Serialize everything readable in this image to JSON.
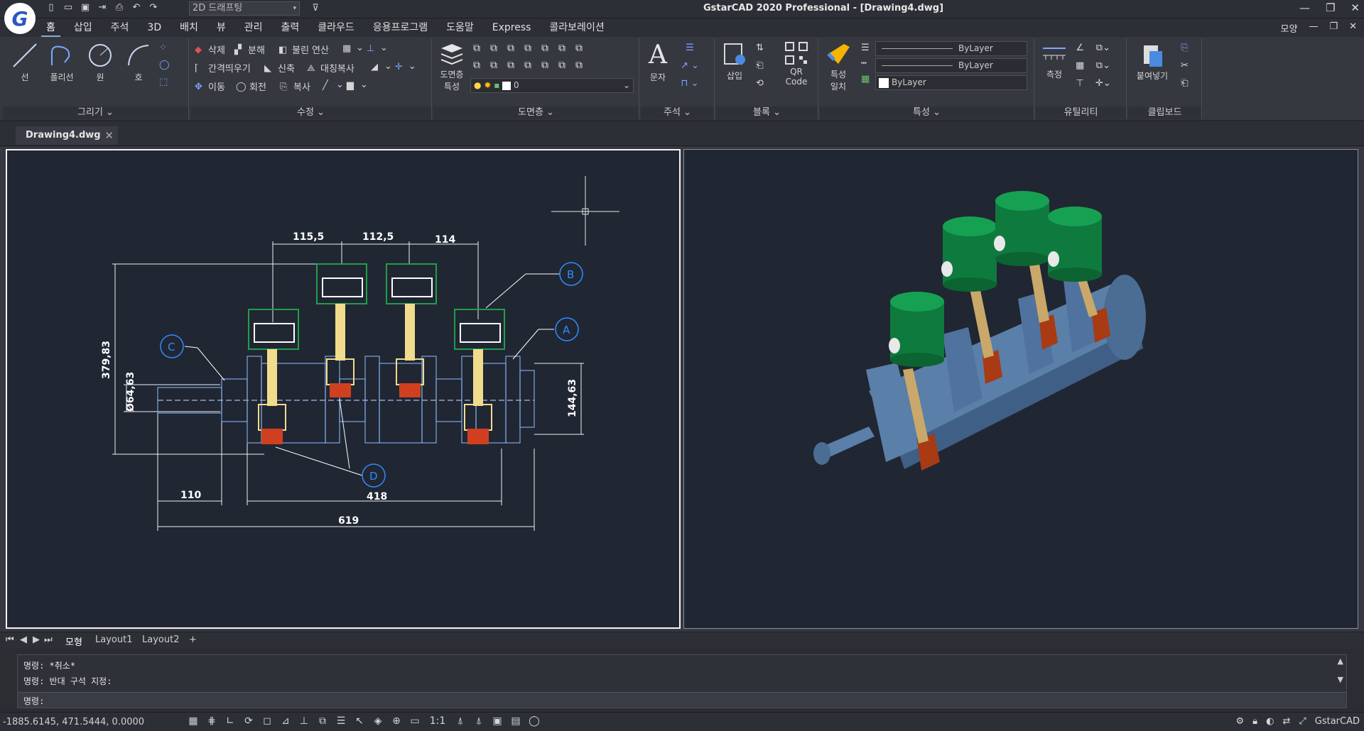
{
  "app": {
    "title": "GstarCAD 2020 Professional - [Drawing4.dwg]",
    "logo_letter": "G",
    "workspace": "2D 드래프팅"
  },
  "menu": {
    "items": [
      "홈",
      "삽입",
      "주석",
      "3D",
      "배치",
      "뷰",
      "관리",
      "출력",
      "클라우드",
      "응용프로그램",
      "도움말",
      "Express",
      "콜라보레이션"
    ],
    "right_label": "모양"
  },
  "ribbon": {
    "draw": {
      "title": "그리기",
      "line": "선",
      "polyline": "폴리선",
      "circle": "원",
      "arc": "호"
    },
    "modify": {
      "title": "수정",
      "erase": "삭제",
      "explode": "분해",
      "boolean": "불린 연산",
      "offset": "간격띄우기",
      "stretch": "신축",
      "mirror": "대칭복사",
      "move": "이동",
      "rotate": "회전",
      "copy": "복사"
    },
    "layers": {
      "title": "도면층",
      "properties_line1": "도면층",
      "properties_line2": "특성",
      "current_layer": "0"
    },
    "annotation": {
      "title": "주석",
      "text": "문자"
    },
    "block": {
      "title": "블록",
      "insert": "삽입",
      "qr_line1": "QR",
      "qr_line2": "Code"
    },
    "properties": {
      "title": "특성",
      "match_line1": "특성",
      "match_line2": "일치",
      "color": "ByLayer",
      "linetype": "ByLayer",
      "lineweight": "ByLayer"
    },
    "utilities": {
      "title": "유틸리티",
      "measure": "측정"
    },
    "clipboard": {
      "title": "클립보드",
      "paste": "붙여넣기"
    }
  },
  "document": {
    "tab": "Drawing4.dwg"
  },
  "drawing": {
    "dims": {
      "d1": "115,5",
      "d2": "112,5",
      "d3": "114",
      "height": "379,83",
      "dia": "Ø64,63",
      "right": "144,63",
      "left": "110",
      "mid": "418",
      "total": "619"
    },
    "balloons": {
      "a": "A",
      "b": "B",
      "c": "C",
      "d": "D"
    },
    "colors": {
      "background": "#212633",
      "dimension": "#ffffff",
      "piston": "#1f9e4a",
      "rod": "#f0dc8c",
      "crank": "#7aa9e0",
      "pin": "#d04020",
      "balloon": "#2f8cff"
    }
  },
  "render3d": {
    "colors": {
      "piston": "#0e7a3e",
      "rod": "#c9a86a",
      "crank": "#5a7fa8",
      "bearing": "#a83a14"
    }
  },
  "layout_tabs": [
    "모형",
    "Layout1",
    "Layout2",
    "+"
  ],
  "command": {
    "history": [
      "명령: *취소*",
      "명령: 반대 구석 지정:"
    ],
    "prompt": "명령:"
  },
  "status": {
    "coords": "-1885.6145, 471.5444, 0.0000",
    "scale": "1:1",
    "app_name": "GstarCAD"
  }
}
